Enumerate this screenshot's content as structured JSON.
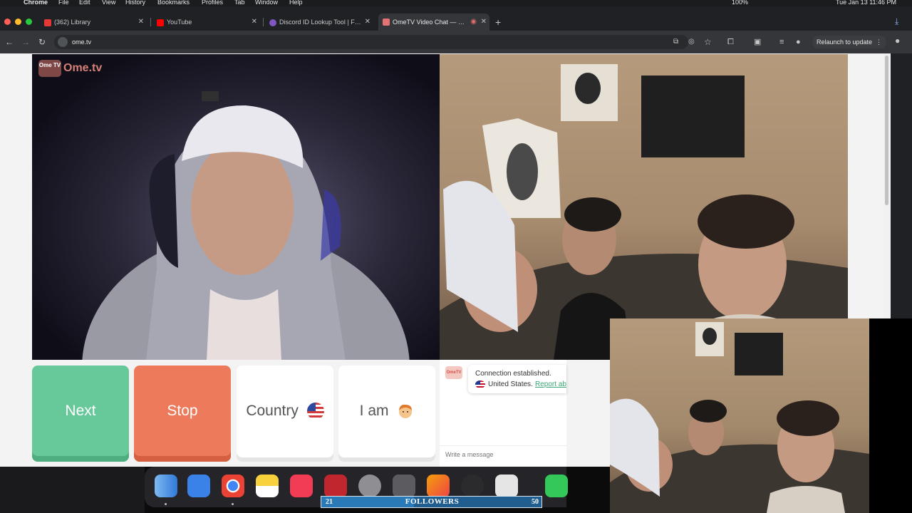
{
  "menubar": {
    "app": "Chrome",
    "items": [
      "File",
      "Edit",
      "View",
      "History",
      "Bookmarks",
      "Profiles",
      "Tab",
      "Window",
      "Help"
    ],
    "battery": "100%",
    "clock": "Tue Jan 13  11:46 PM"
  },
  "tabs": [
    {
      "label": "(362) Library",
      "favicon_color": "#e53935"
    },
    {
      "label": "YouTube",
      "favicon_color": "#ff0000"
    },
    {
      "label": "Discord ID Lookup Tool | Find",
      "favicon_color": "#7e57c2"
    },
    {
      "label": "OmeTV Video Chat — Om",
      "favicon_color": "#e57373",
      "active": true
    }
  ],
  "toolbar": {
    "url": "ome.tv",
    "relaunch_label": "Relaunch to update"
  },
  "logo": {
    "badge": "Ome TV",
    "word": "Ome.tv"
  },
  "controls": {
    "next": "Next",
    "stop": "Stop",
    "country": "Country",
    "iam": "I am"
  },
  "chat": {
    "avatar": "OmeTV",
    "status": "Connection established.",
    "country": "United States.",
    "report": "Report ab",
    "input_placeholder": "Write a message"
  },
  "followers": {
    "current": "21",
    "label": "FOLLOWERS",
    "goal": "50",
    "progress": 0.42
  },
  "colors": {
    "next": "#67c99a",
    "stop": "#ee7a5c",
    "accent_link": "#3aa776"
  }
}
